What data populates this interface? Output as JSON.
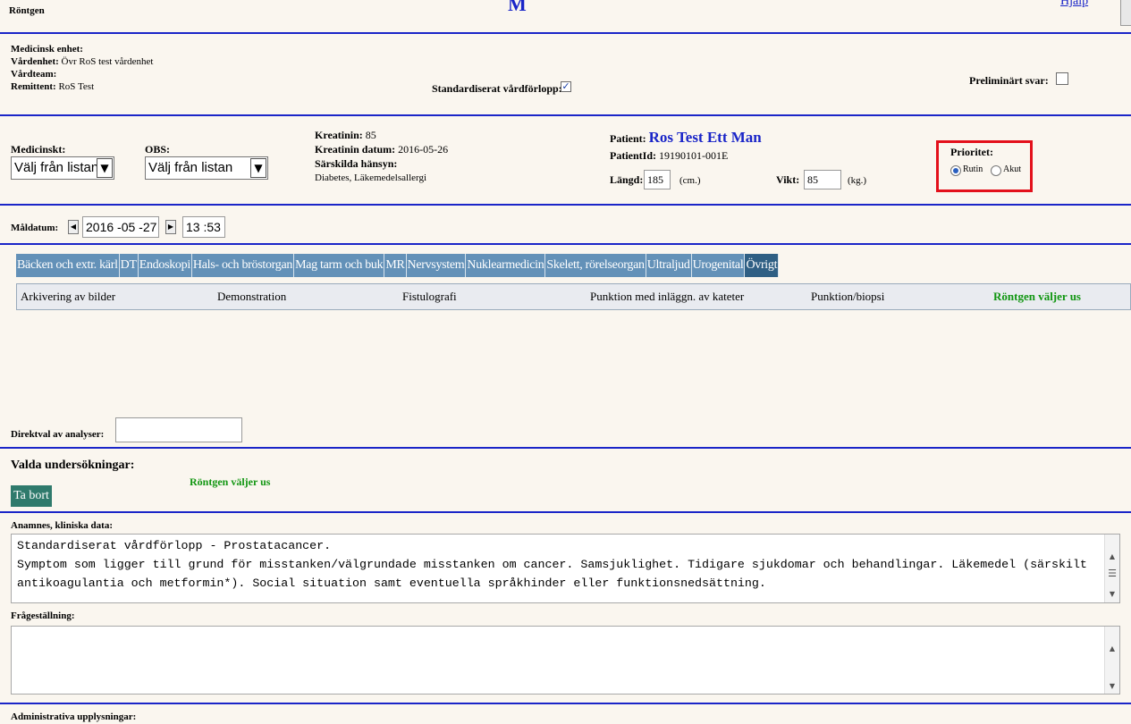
{
  "header": {
    "title": "Röntgen",
    "top_center": "M",
    "help_link": "Hjälp"
  },
  "referral": {
    "medical_unit_label": "Medicinsk enhet:",
    "care_unit_label": "Vårdenhet:",
    "care_unit_value": "Övr RoS test vårdenhet",
    "care_team_label": "Vårdteam:",
    "referrer_label": "Remittent:",
    "referrer_value": "RoS Test",
    "standard_pathway_label": "Standardiserat vårdförlopp:",
    "standard_pathway_checked": "✓",
    "preliminary_answer_label": "Preliminärt svar:"
  },
  "patient_info": {
    "medical_label": "Medicinskt:",
    "medical_value": "Välj från listan",
    "obs_label": "OBS:",
    "obs_value": "Välj från listan",
    "creatinine_label": "Kreatinin:",
    "creatinine_value": "85",
    "creatinine_date_label": "Kreatinin datum:",
    "creatinine_date_value": "2016-05-26",
    "special_label": "Särskilda hänsyn:",
    "special_value": "Diabetes, Läkemedelsallergi",
    "patient_label": "Patient:",
    "patient_name": "Ros Test Ett Man",
    "patient_id_label": "PatientId:",
    "patient_id_value": "19190101-001E",
    "length_label": "Längd:",
    "length_value": "185",
    "length_unit": "(cm.)",
    "weight_label": "Vikt:",
    "weight_value": "85",
    "weight_unit": "(kg.)",
    "priority_label": "Prioritet:",
    "priority_routine": "Rutin",
    "priority_acute": "Akut"
  },
  "target_date": {
    "label": "Måldatum:",
    "date": "2016 -05 -27",
    "time": "13 :53"
  },
  "exam_tabs": [
    "Bäcken och extr. kärl",
    "DT",
    "Endoskopi",
    "Hals- och bröstorgan",
    "Mag tarm och buk",
    "MR",
    "Nervsystem",
    "Nuklearmedicin",
    "Skelett, rörelseorgan",
    "Ultraljud",
    "Urogenital",
    "Övrigt"
  ],
  "exam_items": [
    "Arkivering av bilder",
    "Demonstration",
    "Fistulografi",
    "Punktion med inläggn. av kateter",
    "Punktion/biopsi",
    "Röntgen väljer us"
  ],
  "direct_choice_label": "Direktval av analyser:",
  "selected": {
    "label": "Valda undersökningar:",
    "remove_button": "Ta bort",
    "item": "Röntgen väljer us"
  },
  "anamnesis": {
    "label": "Anamnes, kliniska data:",
    "line1": "Standardiserat vårdförlopp - Prostatacancer.",
    "line2": "Symptom som ligger till grund för misstanken/välgrundade misstanken om cancer. Samsjuklighet. Tidigare sjukdomar och behandlingar. Läkemedel (särskilt",
    "line3": "antikoagulantia och metformin*). Social situation samt eventuella språkhinder eller funktionsnedsättning."
  },
  "question_label": "Frågeställning:",
  "admin_label": "Administrativa upplysningar:",
  "colors": {
    "rule": "#1a25c8",
    "tab": "#6391b8",
    "tab_active": "#2f5f84",
    "highlight_box": "#e3101b",
    "green_text": "#119611",
    "remove_button": "#2f7a6c"
  }
}
